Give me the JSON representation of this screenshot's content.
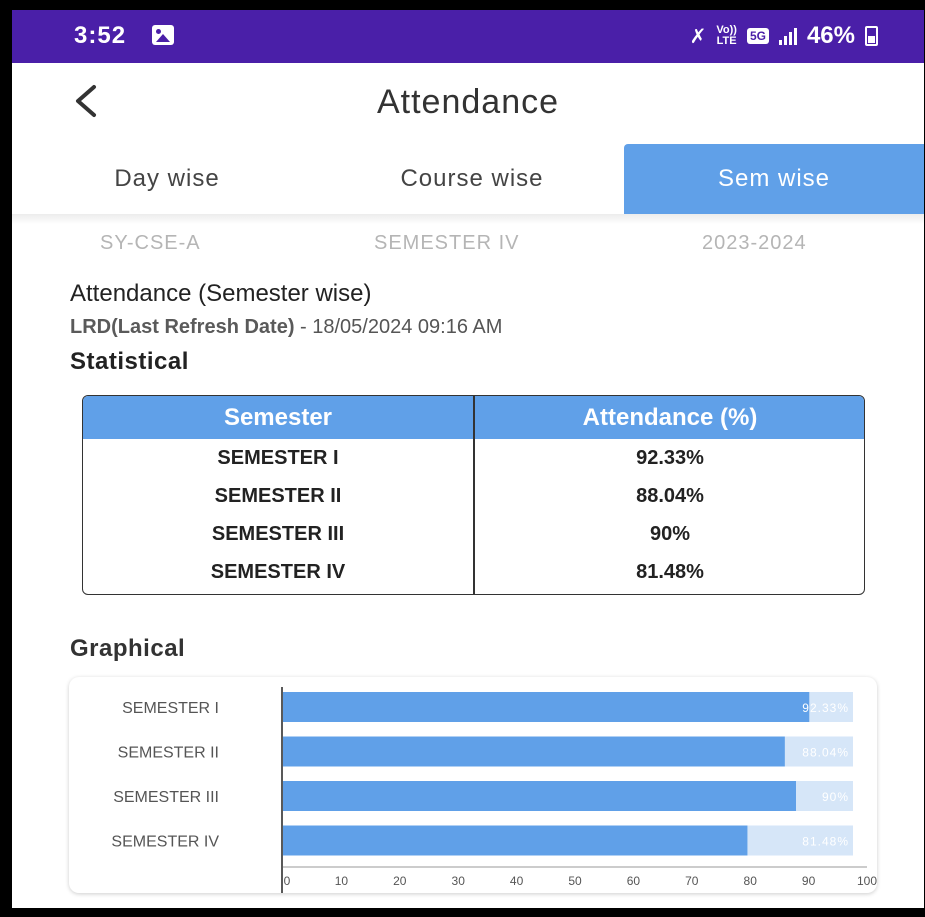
{
  "status_bar": {
    "time": "3:52",
    "net_top": "Vo))",
    "net_bottom": "LTE",
    "five_g": "5G",
    "battery": "46%"
  },
  "header": {
    "title": "Attendance"
  },
  "tabs": [
    {
      "label": "Day wise",
      "active": false
    },
    {
      "label": "Course wise",
      "active": false
    },
    {
      "label": "Sem wise",
      "active": true
    }
  ],
  "meta": {
    "class": "SY-CSE-A",
    "semester": "SEMESTER IV",
    "year": "2023-2024"
  },
  "section": {
    "title": "Attendance (Semester wise)",
    "lrd_label": "LRD(Last Refresh Date)",
    "lrd_value": " - 18/05/2024 09:16 AM",
    "statistical": "Statistical",
    "graphical": "Graphical"
  },
  "table": {
    "headers": [
      "Semester",
      "Attendance (%)"
    ],
    "rows": [
      [
        "SEMESTER I",
        "92.33%"
      ],
      [
        "SEMESTER II",
        "88.04%"
      ],
      [
        "SEMESTER III",
        "90%"
      ],
      [
        "SEMESTER IV",
        "81.48%"
      ]
    ]
  },
  "colors": {
    "status_bar": "#4a1fa8",
    "accent": "#60a0e8",
    "bar_track": "#d6e6f8"
  },
  "chart_data": {
    "type": "bar",
    "orientation": "horizontal",
    "categories": [
      "SEMESTER I",
      "SEMESTER II",
      "SEMESTER III",
      "SEMESTER IV"
    ],
    "values": [
      92.33,
      88.04,
      90,
      81.48
    ],
    "value_labels": [
      "92.33%",
      "88.04%",
      "90%",
      "81.48%"
    ],
    "xlim": [
      0,
      100
    ],
    "x_ticks": [
      0,
      10,
      20,
      30,
      40,
      50,
      60,
      70,
      80,
      90,
      100
    ],
    "grid": false
  }
}
